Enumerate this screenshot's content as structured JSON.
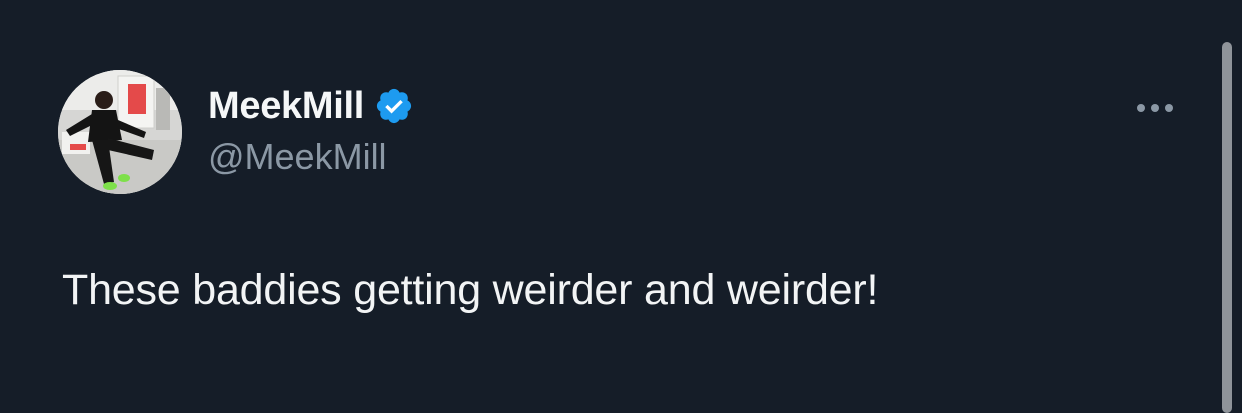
{
  "author": {
    "display_name": "MeekMill",
    "handle": "@MeekMill",
    "verified_icon": "verified-badge-icon",
    "verified_color": "#1d9bf0"
  },
  "menu": {
    "icon": "more-options-icon"
  },
  "tweet": {
    "text": "These baddies getting weirder and weirder!"
  },
  "colors": {
    "background": "#151d28",
    "primary_text": "#e7e9ea",
    "secondary_text": "#8b98a5"
  }
}
